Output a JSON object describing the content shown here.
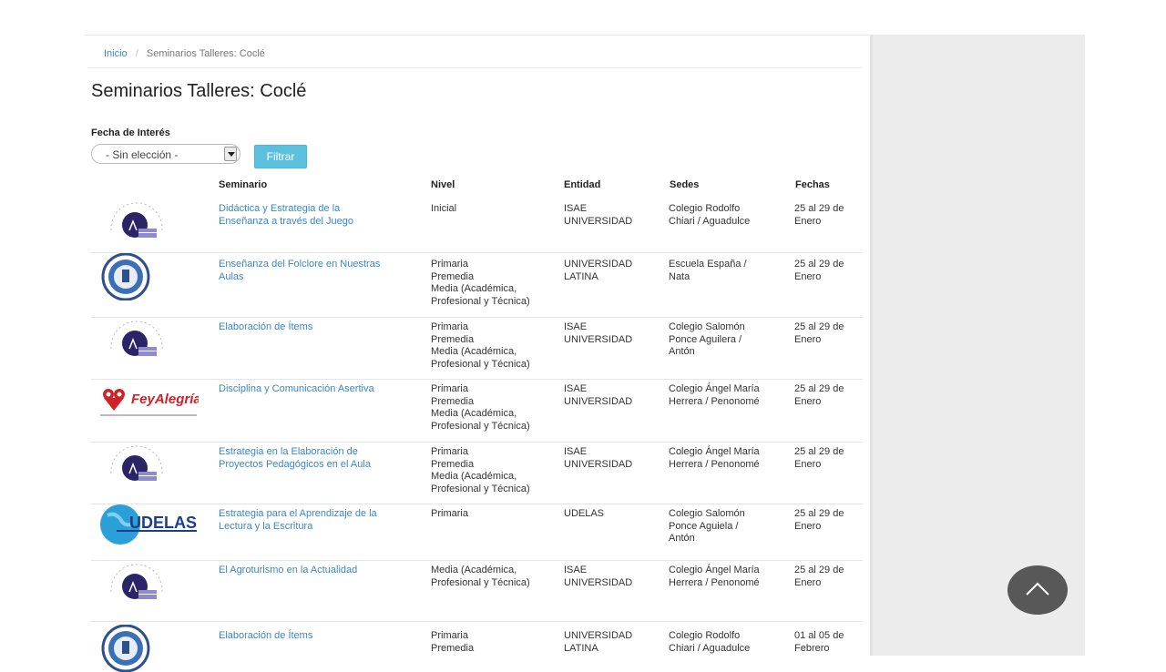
{
  "breadcrumb": {
    "home": "Inicio",
    "current": "Seminarios Talleres: Coclé"
  },
  "page_title": "Seminarios Talleres: Coclé",
  "filter": {
    "label": "Fecha de Interés",
    "selected": "- Sin elección -",
    "button": "Filtrar"
  },
  "table": {
    "headers": {
      "seminario": "Seminario",
      "nivel": "Nivel",
      "entidad": "Entidad",
      "sedes": "Sedes",
      "fechas": "Fechas"
    },
    "rows": [
      {
        "logo": "isae-universidad-logo",
        "seminario": [
          "Didáctica y Estrategia de la",
          "Enseñanza a través del Juego"
        ],
        "nivel": [
          "Inicial"
        ],
        "entidad": [
          "ISAE",
          "UNIVERSIDAD"
        ],
        "sedes": [
          "Colegio Rodolfo",
          "Chiari / Aguadulce"
        ],
        "fechas": [
          "25 al 29 de",
          "Enero"
        ]
      },
      {
        "logo": "universidad-latina-logo",
        "seminario": [
          "Enseñanza del Folclore en Nuestras",
          "Aulas"
        ],
        "nivel": [
          "Primaria",
          "Premedia",
          "Media (Académica,",
          "Profesional y Técnica)"
        ],
        "entidad": [
          "UNIVERSIDAD",
          "LATINA"
        ],
        "sedes": [
          "Escuela España /",
          "Nata"
        ],
        "fechas": [
          "25 al 29 de",
          "Enero"
        ]
      },
      {
        "logo": "isae-universidad-logo",
        "seminario": [
          "Elaboración de Ítems"
        ],
        "nivel": [
          "Primaria",
          "Premedia",
          "Media (Académica,",
          "Profesional y Técnica)"
        ],
        "entidad": [
          "ISAE",
          "UNIVERSIDAD"
        ],
        "sedes": [
          "Colegio Salomón",
          "Ponce Aguilera /",
          "Antón"
        ],
        "fechas": [
          "25 al 29 de",
          "Enero"
        ]
      },
      {
        "logo": "fe-y-alegria-logo",
        "logo_text": "FeyAlegría",
        "seminario": [
          "Disciplina y Comunicación Asertiva"
        ],
        "nivel": [
          "Primaria",
          "Premedia",
          "Media (Académica,",
          "Profesional y Técnica)"
        ],
        "entidad": [
          "ISAE",
          "UNIVERSIDAD"
        ],
        "sedes": [
          "Colegio Ángel María",
          "Herrera / Penonomé"
        ],
        "fechas": [
          "25 al 29 de",
          "Enero"
        ]
      },
      {
        "logo": "isae-universidad-logo",
        "seminario": [
          "Estrategia en la Elaboración de",
          "Proyectos Pedagógicos en el Aula"
        ],
        "nivel": [
          "Primaria",
          "Premedia",
          "Media (Académica,",
          "Profesional y Técnica)"
        ],
        "entidad": [
          "ISAE",
          "UNIVERSIDAD"
        ],
        "sedes": [
          "Colegio Ángel María",
          "Herrera / Penonomé"
        ],
        "fechas": [
          "25 al 29 de",
          "Enero"
        ]
      },
      {
        "logo": "udelas-logo",
        "logo_text": "UDELAS",
        "seminario": [
          "Estrategia para el Aprendizaje de la",
          "Lectura y la Escritura"
        ],
        "nivel": [
          "Primaria"
        ],
        "entidad": [
          "UDELAS"
        ],
        "sedes": [
          "Colegio Salomón",
          "Ponce Aguiela /",
          "Antón"
        ],
        "fechas": [
          "25 al 29 de",
          "Enero"
        ]
      },
      {
        "logo": "isae-universidad-logo",
        "seminario": [
          "El Agroturismo en la Actualidad"
        ],
        "nivel": [
          "Media (Académica,",
          "Profesional y Técnica)"
        ],
        "entidad": [
          "ISAE",
          "UNIVERSIDAD"
        ],
        "sedes": [
          "Colegio Ángel María",
          "Herrera / Penonomé"
        ],
        "fechas": [
          "25 al 29 de",
          "Enero"
        ]
      },
      {
        "logo": "universidad-latina-logo",
        "seminario": [
          "Elaboración de Ítems"
        ],
        "nivel": [
          "Primaria",
          "Premedia"
        ],
        "entidad": [
          "UNIVERSIDAD",
          "LATINA"
        ],
        "sedes": [
          "Colegio Rodolfo",
          "Chiari / Aguadulce"
        ],
        "fechas": [
          "01 al 05 de",
          "Febrero"
        ]
      }
    ]
  },
  "colors": {
    "link": "#3a87c6",
    "button": "#5bc0de",
    "panel": "#ececec",
    "scroll_button": "#585858"
  },
  "icons": {
    "scroll_top": "chevron-up-icon"
  }
}
